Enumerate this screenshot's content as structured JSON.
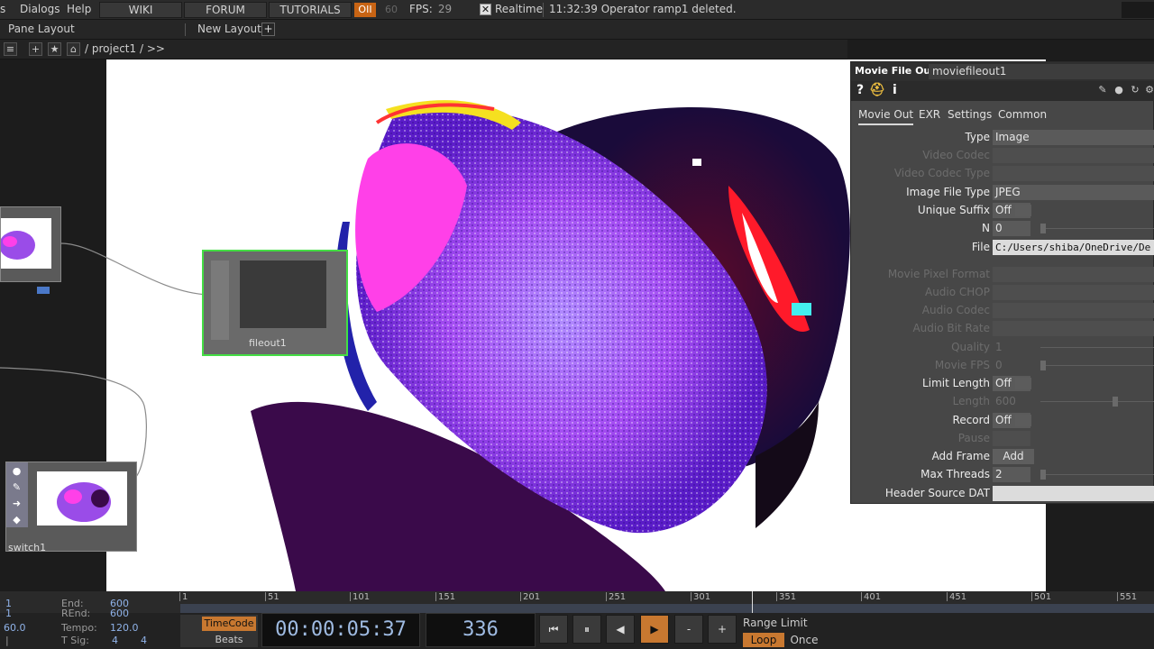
{
  "menubar": {
    "items": [
      "s",
      "Dialogs",
      "Help"
    ],
    "buttons": [
      "WIKI",
      "FORUM",
      "TUTORIALS"
    ],
    "perf_label": "OII",
    "cook_rate_dim": "60",
    "fps_label": "FPS:",
    "fps_value": "29",
    "realtime_label": "Realtime",
    "status_message": "11:32:39 Operator ramp1 deleted.",
    "accent_color": "#c86414"
  },
  "layoutbar": {
    "pane_layout": "Pane Layout",
    "new_layout": "New Layout",
    "add": "+"
  },
  "pathbar": {
    "buttons": [
      "+",
      "★",
      "⌂"
    ],
    "path": "/ project1 / >>"
  },
  "network": {
    "nodes": {
      "selected_label": "fileout1",
      "switch_label": "switch1"
    },
    "selection_color": "#44dd44"
  },
  "params": {
    "op_type": "Movie File Out",
    "op_name": "moviefileout1",
    "tabs": [
      "Movie Out",
      "EXR",
      "Settings",
      "Common"
    ],
    "rows": {
      "type": {
        "label": "Type",
        "value": "Image"
      },
      "video_codec": {
        "label": "Video Codec",
        "value": ""
      },
      "video_codec_type": {
        "label": "Video Codec Type",
        "value": ""
      },
      "image_file_type": {
        "label": "Image File Type",
        "value": "JPEG"
      },
      "unique_suffix": {
        "label": "Unique Suffix",
        "value": "Off"
      },
      "n": {
        "label": "N",
        "value": "0"
      },
      "file": {
        "label": "File",
        "value": "C:/Users/shiba/OneDrive/De"
      },
      "movie_pixel_format": {
        "label": "Movie Pixel Format",
        "value": ""
      },
      "audio_chop": {
        "label": "Audio CHOP",
        "value": ""
      },
      "audio_codec": {
        "label": "Audio Codec",
        "value": ""
      },
      "audio_bit_rate": {
        "label": "Audio Bit Rate",
        "value": ""
      },
      "quality": {
        "label": "Quality",
        "value": "1"
      },
      "movie_fps": {
        "label": "Movie FPS",
        "value": "0"
      },
      "limit_length": {
        "label": "Limit Length",
        "value": "Off"
      },
      "length": {
        "label": "Length",
        "value": "600"
      },
      "record": {
        "label": "Record",
        "value": "Off"
      },
      "pause": {
        "label": "Pause",
        "value": ""
      },
      "add_frame": {
        "label": "Add Frame",
        "value": "Add"
      },
      "max_threads": {
        "label": "Max Threads",
        "value": "2"
      },
      "header_source_dat": {
        "label": "Header Source DAT",
        "value": ""
      }
    }
  },
  "timeline": {
    "ticks": [
      "1",
      "51",
      "101",
      "151",
      "201",
      "251",
      "301",
      "351",
      "401",
      "451",
      "501",
      "551"
    ],
    "start_value": "1",
    "start2_value": "1",
    "rate_value": "60.0",
    "end_label": "End:",
    "end_value": "600",
    "rend_label": "REnd:",
    "rend_value": "600",
    "tempo_label": "Tempo:",
    "tempo_value": "120.0",
    "tsig_label": "T Sig:",
    "tsig_a": "4",
    "tsig_b": "4",
    "timecode_label": "TimeCode",
    "beats_label": "Beats",
    "timecode_value": "00:00:05:37",
    "frame_value": "336",
    "buttons": [
      "⏮",
      "⏸",
      "◀",
      "▶",
      "-",
      "+"
    ],
    "range_limit": "Range Limit",
    "loop": "Loop",
    "once": "Once"
  }
}
